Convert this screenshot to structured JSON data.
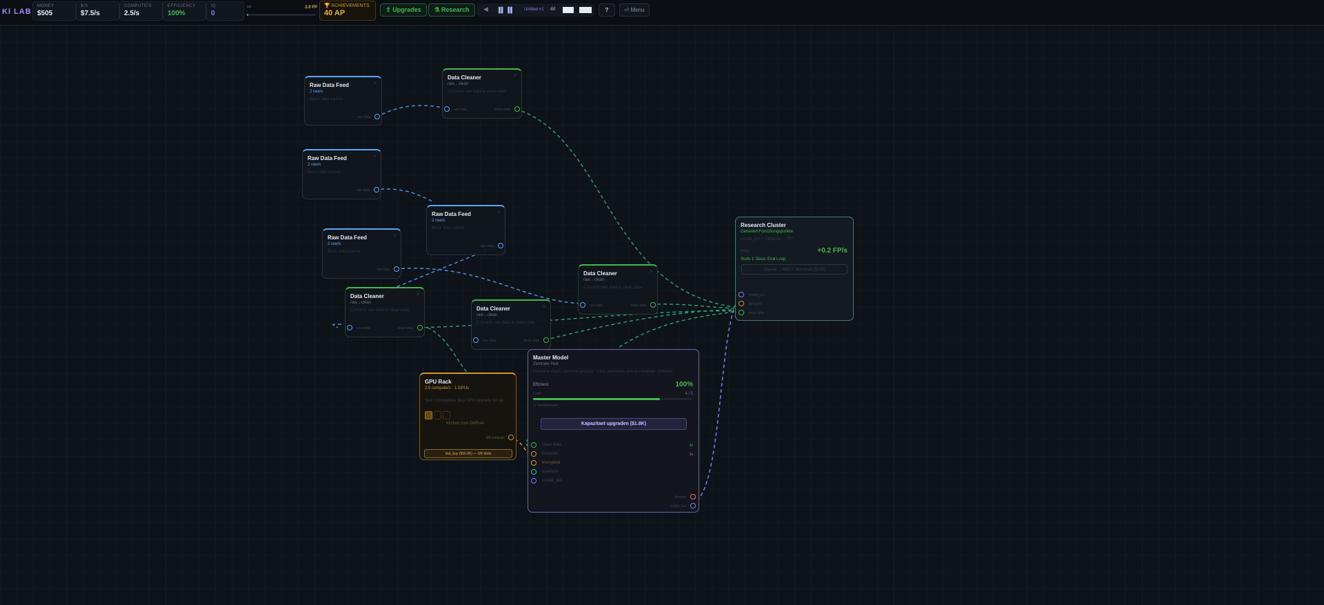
{
  "topbar": {
    "brand": "KI LAB",
    "stats": [
      {
        "label": "MONEY",
        "value": "$505"
      },
      {
        "label": "$/S",
        "value": "$7.5/s"
      },
      {
        "label": "COMPUTE/S",
        "value": "2.5/s"
      },
      {
        "label": "EFFICIENCY",
        "value": "100%"
      },
      {
        "label": "IQ",
        "value": "0"
      }
    ],
    "fp_progress": {
      "label": "FP",
      "target": "2.0 FP",
      "fraction": 0.02
    },
    "achievements": {
      "label": "🏆 ACHIEVEMENTS",
      "value": "40 AP"
    },
    "upgrades_label": "⇧ Upgrades",
    "research_label": "⚗ Research",
    "playbar": {
      "prev": "◀",
      "pause": "▐▌▐▌",
      "name": "Untitled #1",
      "signal": "ılıl"
    },
    "help_label": "?",
    "menu_label": "⏎ Menu"
  },
  "nodes": {
    "raw1": {
      "title": "Raw Data Feed",
      "sub": "2 raw/s",
      "desc": "Basic data source",
      "out": "raw data"
    },
    "raw2": {
      "title": "Raw Data Feed",
      "sub": "2 raw/s",
      "desc": "Basic data source",
      "out": "raw data"
    },
    "raw3": {
      "title": "Raw Data Feed",
      "sub": "2 raw/s",
      "desc": "Basic data source",
      "out": "raw data"
    },
    "raw4": {
      "title": "Raw Data Feed",
      "sub": "2 raw/s",
      "desc": "Basic data source",
      "out": "raw data"
    },
    "clean1": {
      "title": "Data Cleaner",
      "sub": "raw→clean",
      "desc": "Converts raw data to clean data",
      "in": "raw data",
      "out": "clean data"
    },
    "clean2": {
      "title": "Data Cleaner",
      "sub": "raw→clean",
      "desc": "Converts raw data to clean data",
      "in": "raw data",
      "out": "clean data"
    },
    "clean3": {
      "title": "Data Cleaner",
      "sub": "raw→clean",
      "desc": "Converts raw data to clean data",
      "in": "raw data",
      "out": "clean data"
    },
    "clean4": {
      "title": "Data Cleaner",
      "sub": "raw→clean",
      "desc": "Converts raw data to clean data",
      "in": "raw data",
      "out": "clean data"
    },
    "research": {
      "title": "Research Cluster",
      "sub": "Generiert Forschungspunkte",
      "desc": "model_out + compute → FP",
      "stat_label": "FP/s",
      "stat_value": "+0.2 FP/s",
      "level": "Stufe 1: Basic Eval Loop",
      "upgrade": "Upgrade → RMIL S: Benchmark ($1.5K)",
      "inputs": [
        "model_out",
        "compute",
        "clean data"
      ]
    },
    "master": {
      "title": "Master Model",
      "sub": "Zentraler Hub",
      "desc": "Combine inputs into final product. Train, normalize and re-integrate. Efficient.",
      "eff_label": "Effizienz",
      "eff_value": "100%",
      "load_label": "Load",
      "load_value": "4 / 5",
      "load_fraction": 0.8,
      "conn_label": "⊙ Verbindungen",
      "upgrade": "Kapazitaet upgraden ($1.8K)",
      "inputs": [
        {
          "name": "clean data",
          "mult": "3x"
        },
        {
          "name": "compute",
          "mult": "1x"
        },
        {
          "name": "encrypted",
          "mult": ""
        },
        {
          "name": "quantum",
          "mult": ""
        },
        {
          "name": "model_out",
          "mult": ""
        }
      ],
      "outputs": [
        "finance",
        "model_out"
      ]
    },
    "gpu": {
      "title": "GPU Rack",
      "sub": "2.5 compute/s · 1 GPUs",
      "desc": "Slot + compute/s. Buy GPU upgrade for up",
      "hint": "Klicken zum Oeffnen",
      "out": "5/8 compute",
      "buy": "slot_buy ($50.0K) — 3/8 Slots"
    }
  },
  "colors": {
    "raw": "#58a6ff",
    "clean": "#3fb950",
    "compute": "#d29922",
    "model": "#8b7cf6"
  }
}
